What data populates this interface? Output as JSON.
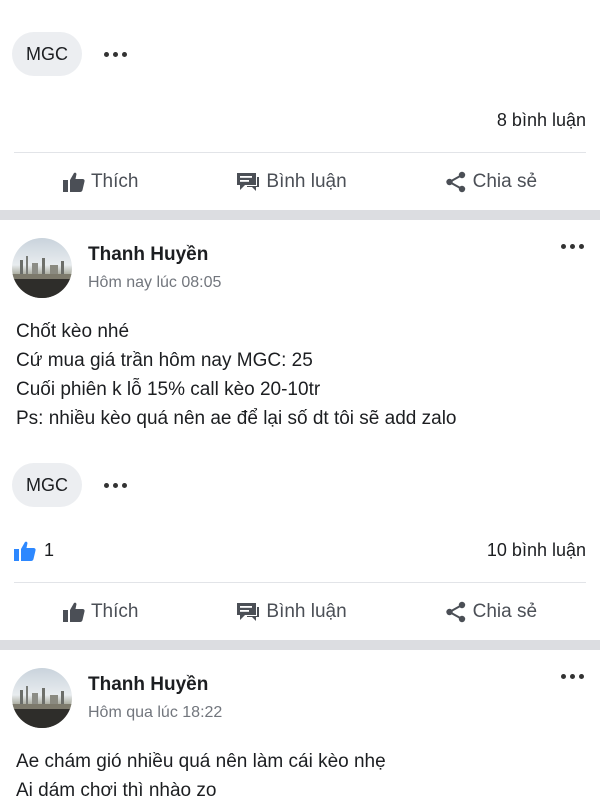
{
  "colors": {
    "separator": "#dcdde1",
    "like_blue": "#2d88ff",
    "action_gray": "#4b4f56"
  },
  "top_card": {
    "tag": "MGC",
    "comments": "8 bình luận"
  },
  "actions": {
    "like": "Thích",
    "comment": "Bình luận",
    "share": "Chia sẻ"
  },
  "posts": [
    {
      "author": "Thanh Huyền",
      "time": "Hôm nay lúc 08:05",
      "lines": [
        "Chốt kèo nhé",
        "Cứ mua giá trần hôm nay MGC: 25",
        "Cuối phiên k lỗ 15% call kèo 20-10tr",
        "Ps: nhiều kèo quá nên ae để lại số dt tôi sẽ add zalo"
      ],
      "tag": "MGC",
      "like_count": "1",
      "comments": "10 bình luận"
    },
    {
      "author": "Thanh Huyền",
      "time": "Hôm qua lúc 18:22",
      "lines": [
        "Ae chám gió nhiều quá nên làm cái kèo nhẹ",
        "Ai dám chơi thì nhào zo"
      ]
    }
  ],
  "icons": {
    "more": "more-dots-icon",
    "like": "thumbs-up-icon",
    "comment": "comment-bubble-icon",
    "share": "share-icon",
    "like_reaction": "like-reaction-icon"
  }
}
